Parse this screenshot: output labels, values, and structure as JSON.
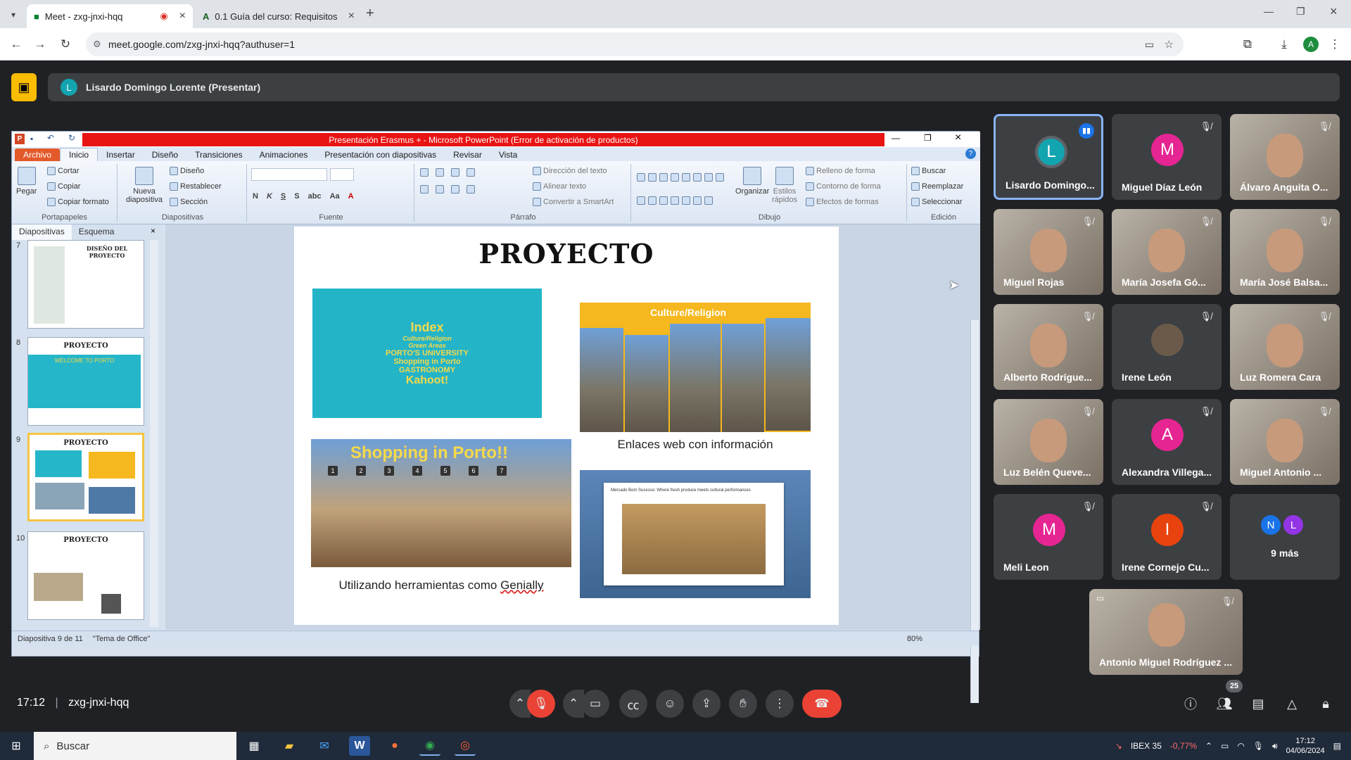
{
  "browser": {
    "tabs": [
      {
        "title": "Meet - zxg-jnxi-hqq",
        "active": true
      },
      {
        "title": "0.1 Guía del curso: Requisitos",
        "active": false
      }
    ],
    "url": "meet.google.com/zxg-jnxi-hqq?authuser=1",
    "profile_initial": "A"
  },
  "meet": {
    "presenter_initial": "L",
    "presenter_label": "Lisardo Domingo Lorente (Presentar)",
    "time": "17:12",
    "meeting_code": "zxg-jnxi-hqq",
    "participants_count": "25",
    "participants": [
      {
        "name": "Lisardo Domingo...",
        "initial": "L",
        "color": "#12a4af"
      },
      {
        "name": "Miguel Díaz León",
        "initial": "M",
        "color": "#e52592"
      },
      {
        "name": "Álvaro Anguita O...",
        "initial": "",
        "color": ""
      },
      {
        "name": "Miguel Rojas",
        "initial": "",
        "color": ""
      },
      {
        "name": "María Josefa Gó...",
        "initial": "",
        "color": ""
      },
      {
        "name": "María José Balsa...",
        "initial": "",
        "color": ""
      },
      {
        "name": "Alberto Rodrígue...",
        "initial": "",
        "color": ""
      },
      {
        "name": "Irene León",
        "initial": "",
        "color": ""
      },
      {
        "name": "Luz Romera Cara",
        "initial": "",
        "color": ""
      },
      {
        "name": "Luz Belén Queve...",
        "initial": "",
        "color": ""
      },
      {
        "name": "Alexandra Villega...",
        "initial": "A",
        "color": "#e52592"
      },
      {
        "name": "Miguel Antonio ...",
        "initial": "",
        "color": ""
      },
      {
        "name": "Meli Leon",
        "initial": "M",
        "color": "#e52592"
      },
      {
        "name": "Irene Cornejo Cu...",
        "initial": "I",
        "color": "#e8430e"
      },
      {
        "name": "Antonio Miguel Rodríguez ...",
        "initial": "",
        "color": ""
      }
    ],
    "more": {
      "label": "9 más",
      "initials": [
        "N",
        "L"
      ],
      "colors": [
        "#1a73e8",
        "#9334e6"
      ]
    }
  },
  "ppt": {
    "title": "Presentación Erasmus + - Microsoft PowerPoint (Error de activación de productos)",
    "menu": [
      "Archivo",
      "Inicio",
      "Insertar",
      "Diseño",
      "Transiciones",
      "Animaciones",
      "Presentación con diapositivas",
      "Revisar",
      "Vista"
    ],
    "ribbon": {
      "portapapeles": {
        "label": "Portapapeles",
        "pegar": "Pegar",
        "cortar": "Cortar",
        "copiar": "Copiar",
        "copiar_formato": "Copiar formato"
      },
      "diapositivas": {
        "label": "Diapositivas",
        "nueva": "Nueva diapositiva",
        "diseno": "Diseño",
        "restablecer": "Restablecer",
        "seccion": "Sección"
      },
      "fuente": {
        "label": "Fuente"
      },
      "parrafo": {
        "label": "Párrafo",
        "direccion": "Dirección del texto",
        "alinear": "Alinear texto",
        "smartart": "Convertir a SmartArt"
      },
      "dibujo": {
        "label": "Dibujo",
        "organizar": "Organizar",
        "estilos": "Estilos rápidos",
        "relleno": "Relleno de forma",
        "contorno": "Contorno de forma",
        "efectos": "Efectos de formas"
      },
      "edicion": {
        "label": "Edición",
        "buscar": "Buscar",
        "reemplazar": "Reemplazar",
        "seleccionar": "Seleccionar"
      }
    },
    "panel_tabs": [
      "Diapositivas",
      "Esquema"
    ],
    "thumbnails": [
      {
        "num": "7",
        "title": "DISEÑO DEL PROYECTO"
      },
      {
        "num": "8",
        "title": "PROYECTO",
        "sub": "WELCOME TO PORTO"
      },
      {
        "num": "9",
        "title": "PROYECTO"
      },
      {
        "num": "10",
        "title": "PROYECTO"
      }
    ],
    "slide": {
      "title": "PROYECTO",
      "index": {
        "l1": "Index",
        "l2a": "Culture/Religion",
        "l2b": "Green Areas",
        "l3a": "PORTO'S UNIVERSITY",
        "l3b": "Shopping in Porto",
        "l3c": "GASTRONOMY",
        "l4": "Kahoot!"
      },
      "culture_label": "Culture/Religion",
      "culture_caption": "Enlaces web con información",
      "shop_label": "Shopping in Porto!!",
      "shop_nums": [
        "1",
        "2",
        "3",
        "4",
        "5",
        "6",
        "7"
      ],
      "shop_caption_a": "Utilizando herramientas como ",
      "shop_caption_b": "Genially",
      "market_caption": "Mercado Bom Sucesso: Where fresh produce meets cultural performances"
    },
    "status": {
      "slide": "Diapositiva 9 de 11",
      "theme": "\"Tema de Office\"",
      "zoom": "80%"
    }
  },
  "taskbar": {
    "search": "Buscar",
    "stock_name": "IBEX 35",
    "stock_change": "-0,77%",
    "time": "17:12",
    "date": "04/06/2024"
  }
}
